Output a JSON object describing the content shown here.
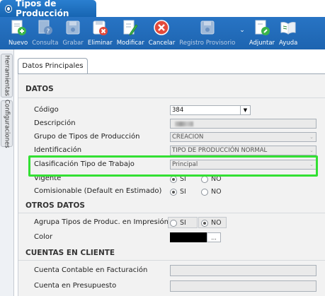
{
  "window": {
    "title": "Tipos de Producción"
  },
  "toolbar": {
    "buttons": [
      {
        "label": "Nuevo",
        "icon": "new-record-icon",
        "enabled": true
      },
      {
        "label": "Consulta",
        "icon": "query-icon",
        "enabled": false
      },
      {
        "label": "Grabar",
        "icon": "save-icon",
        "enabled": false
      },
      {
        "label": "Eliminar",
        "icon": "delete-icon",
        "enabled": true
      },
      {
        "label": "Modificar",
        "icon": "edit-icon",
        "enabled": true
      },
      {
        "label": "Cancelar",
        "icon": "cancel-icon",
        "enabled": true
      },
      {
        "label": "Registro Provisorio",
        "icon": "provisional-save-icon",
        "enabled": false
      },
      {
        "label": "Adjuntar",
        "icon": "attach-icon",
        "enabled": true
      },
      {
        "label": "Ayuda",
        "icon": "help-book-icon",
        "enabled": true
      }
    ]
  },
  "side_tabs": [
    "Herramientas",
    "Configuraciones"
  ],
  "tab": {
    "label": "Datos Principales"
  },
  "datos": {
    "heading": "DATOS",
    "codigo": {
      "label": "Código",
      "value": "384"
    },
    "descripcion": {
      "label": "Descripción"
    },
    "grupo": {
      "label": "Grupo de Tipos de Producción",
      "value": "CREACION"
    },
    "identificacion": {
      "label": "Identificación",
      "value": "TIPO DE PRODUCCIÓN NORMAL"
    },
    "clasificacion": {
      "label": "Clasificación Tipo de Trabajo",
      "value": "Principal"
    },
    "vigente": {
      "label": "Vigente",
      "si": "SI",
      "no": "NO",
      "selected": "SI"
    },
    "comisionable": {
      "label": "Comisionable (Default en Estimado)",
      "si": "SI",
      "no": "NO",
      "selected": "SI"
    }
  },
  "otros": {
    "heading": "OTROS DATOS",
    "agrupa": {
      "label": "Agrupa Tipos de Produc. en Impresión",
      "si": "SI",
      "no": "NO",
      "selected": "NO"
    },
    "color": {
      "label": "Color",
      "value_color": "#000000",
      "button": "..."
    }
  },
  "cuentas": {
    "heading": "CUENTAS EN CLIENTE",
    "facturacion": {
      "label": "Cuenta Contable en Facturación",
      "value": ""
    },
    "presupuesto": {
      "label": "Cuenta en Presupuesto",
      "value": ""
    }
  },
  "colors": {
    "toolbar": "#1d64b0",
    "highlight": "#33e033",
    "panel": "#f2f2f2"
  }
}
